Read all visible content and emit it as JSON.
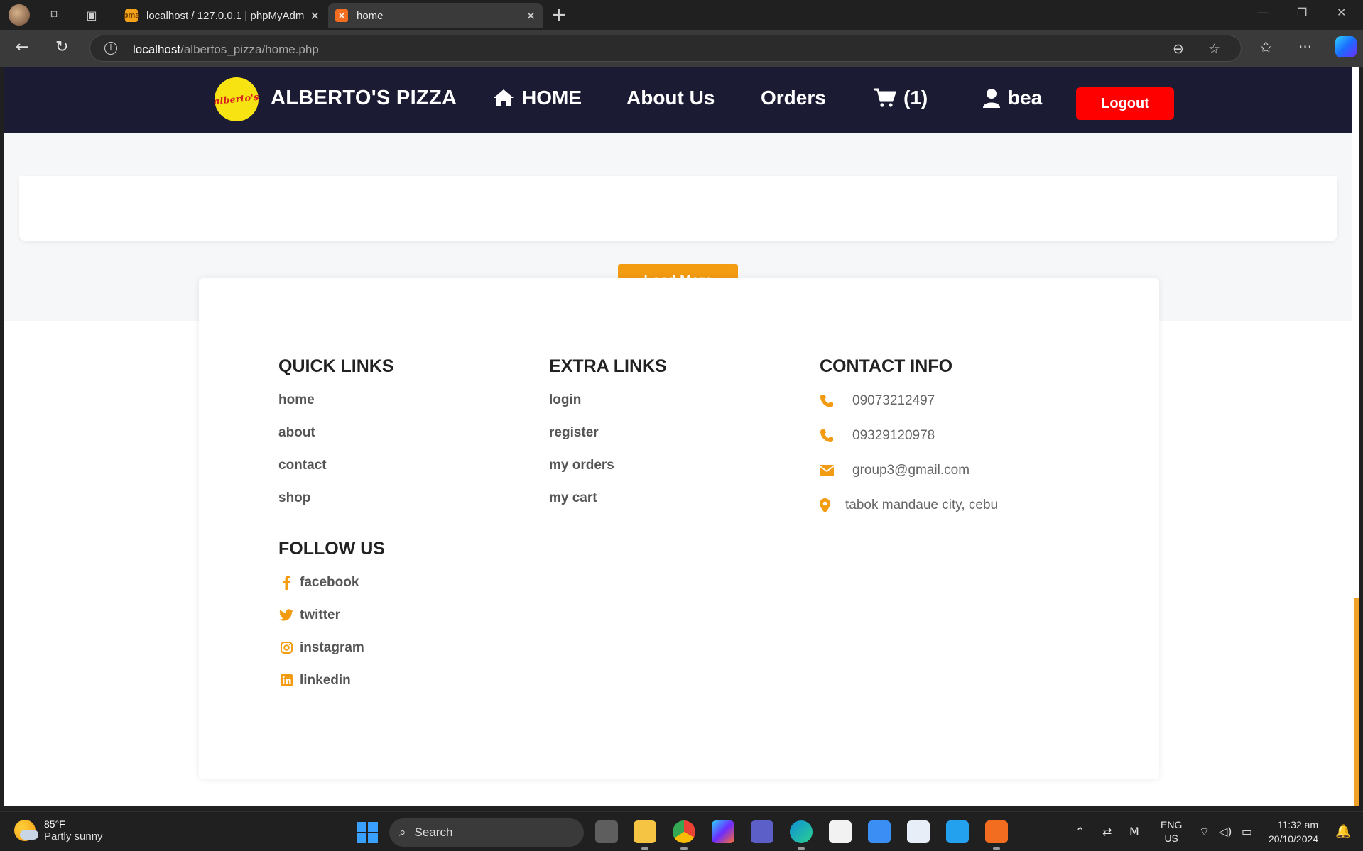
{
  "browser": {
    "tabs": [
      {
        "title": "localhost / 127.0.0.1 | phpMyAdm",
        "active": false
      },
      {
        "title": "home",
        "active": true
      }
    ],
    "address": {
      "host": "localhost",
      "path": "/albertos_pizza/home.php"
    }
  },
  "site": {
    "logo_text": "alberto's",
    "brand": "ALBERTO'S PIZZA",
    "nav": {
      "home": "HOME",
      "about": "About Us",
      "orders": "Orders",
      "cart": "(1)",
      "user": "bea",
      "logout": "Logout"
    },
    "load_more": "Load More",
    "accent_color": "#f39c12",
    "header_color": "#1b1b33",
    "logout_color": "#ff0000"
  },
  "footer": {
    "quick_links": {
      "title": "QUICK LINKS",
      "items": [
        "home",
        "about",
        "contact",
        "shop"
      ]
    },
    "extra_links": {
      "title": "EXTRA LINKS",
      "items": [
        "login",
        "register",
        "my orders",
        "my cart"
      ]
    },
    "contact_info": {
      "title": "CONTACT INFO",
      "phone1": "09073212497",
      "phone2": "09329120978",
      "email": "group3@gmail.com",
      "address": "tabok mandaue city, cebu"
    },
    "follow_us": {
      "title": "FOLLOW US",
      "items": [
        {
          "label": "facebook",
          "icon": "facebook-icon"
        },
        {
          "label": "twitter",
          "icon": "twitter-icon"
        },
        {
          "label": "instagram",
          "icon": "instagram-icon"
        },
        {
          "label": "linkedin",
          "icon": "linkedin-icon"
        }
      ]
    }
  },
  "taskbar": {
    "weather": {
      "temp": "85°F",
      "condition": "Partly sunny"
    },
    "search_label": "Search",
    "lang": {
      "line1": "ENG",
      "line2": "US"
    },
    "clock": {
      "time": "11:32 am",
      "date": "20/10/2024"
    }
  }
}
